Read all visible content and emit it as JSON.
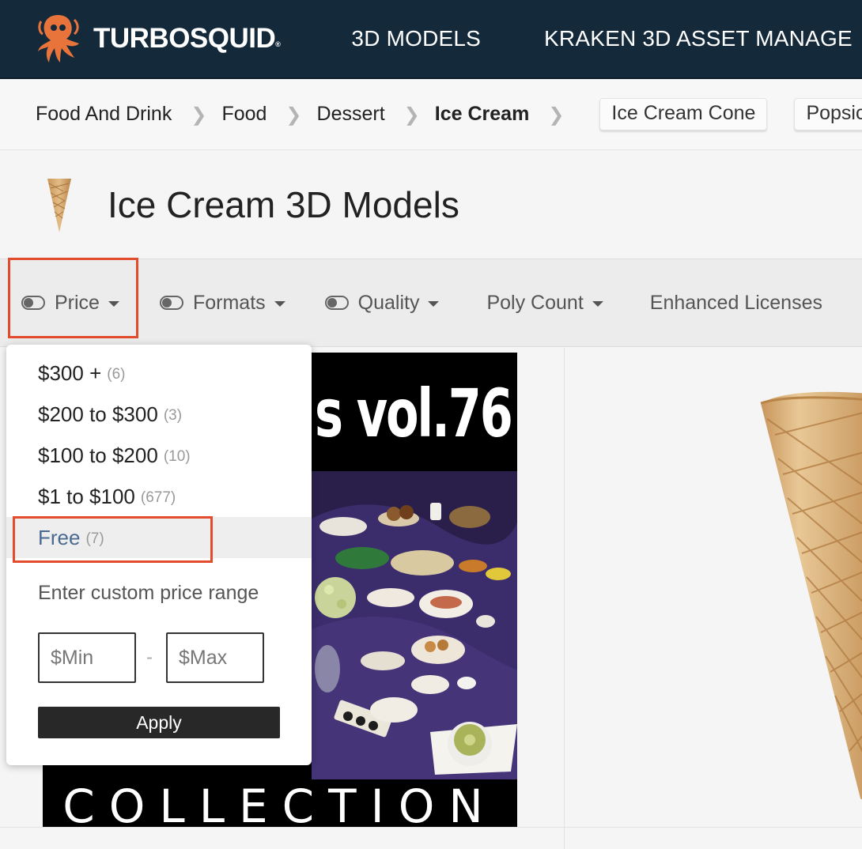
{
  "header": {
    "logo_text": "TURBOSQUID",
    "logo_mark": "®",
    "nav": [
      "3D MODELS",
      "KRAKEN 3D ASSET MANAGE"
    ]
  },
  "breadcrumb": {
    "items": [
      "Food And Drink",
      "Food",
      "Dessert",
      "Ice Cream"
    ],
    "related": [
      "Ice Cream Cone",
      "Popsicle"
    ]
  },
  "page": {
    "title": "Ice Cream 3D Models"
  },
  "filters": {
    "price": "Price",
    "formats": "Formats",
    "quality": "Quality",
    "poly_count": "Poly Count",
    "licenses": "Enhanced Licenses"
  },
  "price_dropdown": {
    "options": [
      {
        "label": "$300 +",
        "count": "(6)"
      },
      {
        "label": "$200 to $300",
        "count": "(3)"
      },
      {
        "label": "$100 to $200",
        "count": "(10)"
      },
      {
        "label": "$1 to $100",
        "count": "(677)"
      },
      {
        "label": "Free",
        "count": "(7)",
        "selected": true
      }
    ],
    "custom_label": "Enter custom price range",
    "min_placeholder": "$Min",
    "max_placeholder": "$Max",
    "separator": "-",
    "apply_label": "Apply"
  },
  "results": {
    "poster_headline": "s vol.76",
    "poster_footer": "COLLECTION"
  },
  "colors": {
    "header_bg": "#14293a",
    "highlight": "#e34b2d",
    "selected_text": "#4b6a90",
    "apply_bg": "#282828"
  }
}
